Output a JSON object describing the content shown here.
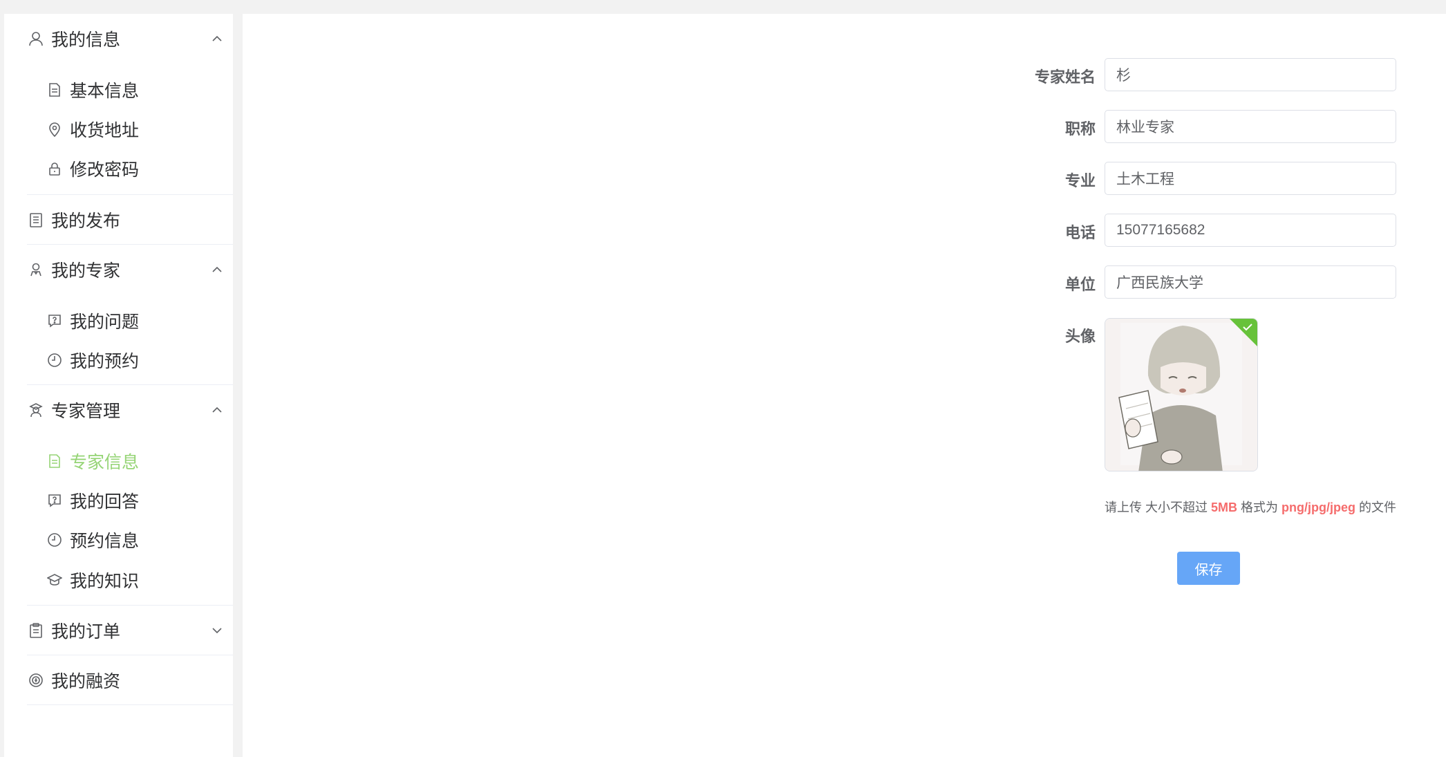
{
  "sidebar": {
    "my_info": {
      "label": "我的信息",
      "icon": "user-icon",
      "expanded": true
    },
    "basic_info": {
      "label": "基本信息",
      "icon": "document-icon"
    },
    "address": {
      "label": "收货地址",
      "icon": "location-pin-icon"
    },
    "password": {
      "label": "修改密码",
      "icon": "lock-icon"
    },
    "my_posts": {
      "label": "我的发布",
      "icon": "list-icon"
    },
    "my_experts": {
      "label": "我的专家",
      "icon": "expert-icon",
      "expanded": true
    },
    "my_questions": {
      "label": "我的问题",
      "icon": "question-icon"
    },
    "my_appointments": {
      "label": "我的预约",
      "icon": "clock-icon"
    },
    "expert_mgmt": {
      "label": "专家管理",
      "icon": "expert-manage-icon",
      "expanded": true
    },
    "expert_info": {
      "label": "专家信息",
      "icon": "document-icon",
      "active": true
    },
    "my_answers": {
      "label": "我的回答",
      "icon": "question-icon"
    },
    "appointment_info": {
      "label": "预约信息",
      "icon": "clock-icon"
    },
    "my_knowledge": {
      "label": "我的知识",
      "icon": "graduation-cap-icon"
    },
    "my_orders": {
      "label": "我的订单",
      "icon": "clipboard-icon",
      "expanded": false
    },
    "my_financing": {
      "label": "我的融资",
      "icon": "coin-icon"
    }
  },
  "form": {
    "name": {
      "label": "专家姓名",
      "value": "杉"
    },
    "title": {
      "label": "职称",
      "value": "林业专家"
    },
    "major": {
      "label": "专业",
      "value": "土木工程"
    },
    "phone": {
      "label": "电话",
      "value": "15077165682"
    },
    "unit": {
      "label": "单位",
      "value": "广西民族大学"
    },
    "avatar": {
      "label": "头像",
      "uploaded": true
    },
    "hint": {
      "prefix": "请上传 大小不超过 ",
      "size": "5MB",
      "middle": " 格式为 ",
      "formats": "png/jpg/jpeg",
      "suffix": " 的文件"
    },
    "save_label": "保存"
  },
  "colors": {
    "active": "#95d475",
    "primary_button": "#66a6f7",
    "success_badge": "#67c23a",
    "hint_highlight": "#f56c6c"
  }
}
